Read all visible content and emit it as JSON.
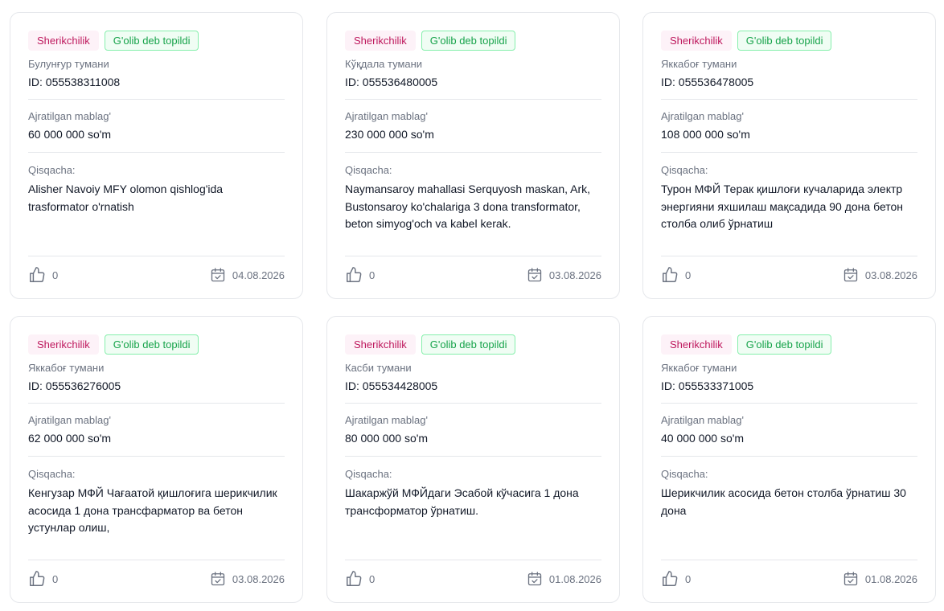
{
  "cards": [
    {
      "type_tag": "Sherikchilik",
      "status_tag": "G'olib deb topildi",
      "region": "Булунғур тумани",
      "id": "ID: 055538311008",
      "amount_label": "Ajratilgan mablag'",
      "amount": "60 000 000 so'm",
      "summary_label": "Qisqacha:",
      "summary": "Alisher Navoiy MFY olomon qishlog'ida trasformator o'rnatish",
      "likes": "0",
      "date": "04.08.2026"
    },
    {
      "type_tag": "Sherikchilik",
      "status_tag": "G'olib deb topildi",
      "region": "Кўқдала тумани",
      "id": "ID: 055536480005",
      "amount_label": "Ajratilgan mablag'",
      "amount": "230 000 000 so'm",
      "summary_label": "Qisqacha:",
      "summary": "Naymansaroy mahallasi Serquyosh maskan, Ark, Bustonsaroy ko'chalariga 3 dona transformator, beton simyog'och va kabel kerak.",
      "likes": "0",
      "date": "03.08.2026"
    },
    {
      "type_tag": "Sherikchilik",
      "status_tag": "G'olib deb topildi",
      "region": "Яккабоғ тумани",
      "id": "ID: 055536478005",
      "amount_label": "Ajratilgan mablag'",
      "amount": "108 000 000 so'm",
      "summary_label": "Qisqacha:",
      "summary": "Турон МФЙ Терак қишлоғи кучаларида электр энергияни яхшилаш мақсадида 90 дона бетон столба олиб ўрнатиш",
      "likes": "0",
      "date": "03.08.2026"
    },
    {
      "type_tag": "Sherikchilik",
      "status_tag": "G'olib deb topildi",
      "region": "Яккабоғ тумани",
      "id": "ID: 055536276005",
      "amount_label": "Ajratilgan mablag'",
      "amount": "62 000 000 so'm",
      "summary_label": "Qisqacha:",
      "summary": "Кенгузар МФЙ Чағаатой қишлоғига шерикчилик асосида 1 дона трансфарматор ва бетон устунлар олиш,",
      "likes": "0",
      "date": "03.08.2026"
    },
    {
      "type_tag": "Sherikchilik",
      "status_tag": "G'olib deb topildi",
      "region": "Касби тумани",
      "id": "ID: 055534428005",
      "amount_label": "Ajratilgan mablag'",
      "amount": "80 000 000 so'm",
      "summary_label": "Qisqacha:",
      "summary": "Шакаржўй МФЙдаги Эсабой кўчасига 1 дона трансформатор ўрнатиш.",
      "likes": "0",
      "date": "01.08.2026"
    },
    {
      "type_tag": "Sherikchilik",
      "status_tag": "G'olib deb topildi",
      "region": "Яккабоғ тумани",
      "id": "ID: 055533371005",
      "amount_label": "Ajratilgan mablag'",
      "amount": "40 000 000 so'm",
      "summary_label": "Qisqacha:",
      "summary": "Шерикчилик асосида бетон столба ўрнатиш 30 дона",
      "likes": "0",
      "date": "01.08.2026"
    }
  ]
}
